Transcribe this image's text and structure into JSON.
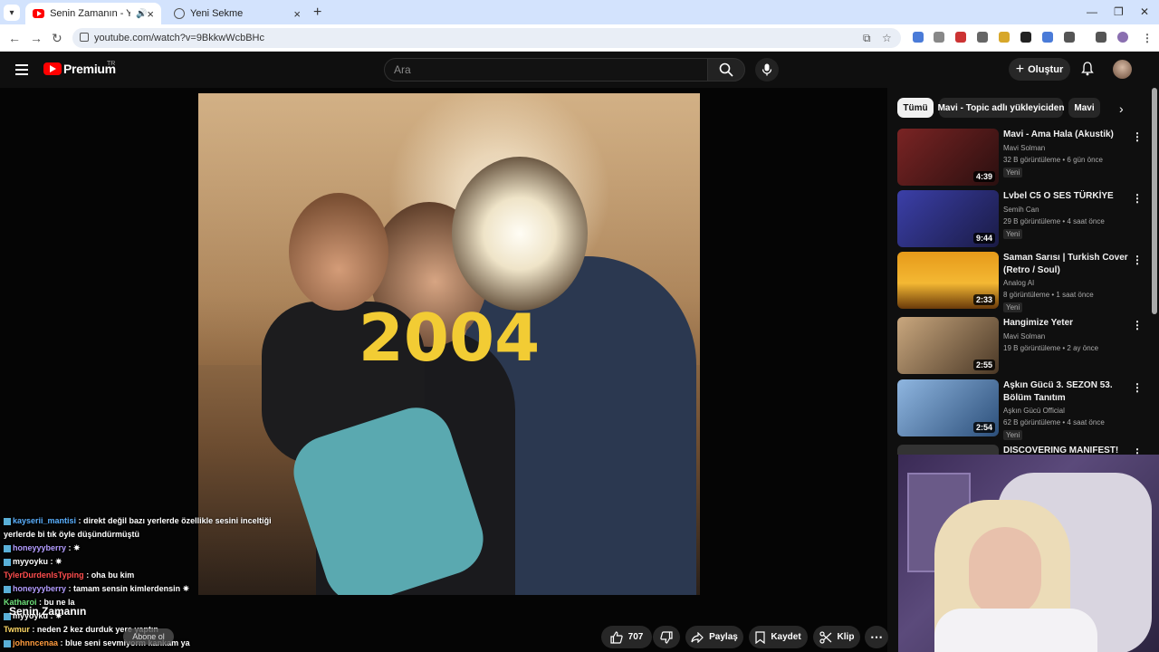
{
  "browser": {
    "tabs": [
      {
        "title": "Senin Zamanın - YouTube",
        "active": true
      },
      {
        "title": "Yeni Sekme",
        "active": false
      }
    ],
    "url": "youtube.com/watch?v=9BkkwWcbBHc"
  },
  "header": {
    "logo_text": "Premium",
    "region": "TR",
    "search_placeholder": "Ara",
    "create_label": "Oluştur"
  },
  "video": {
    "year_overlay": "2004",
    "title_overlay": "Senin Zamanın",
    "subscribe_overlay": "Abone ol",
    "likes": "707",
    "share_label": "Paylaş",
    "save_label": "Kaydet",
    "clip_label": "Klip"
  },
  "chat": [
    {
      "user": "kayserii_mantisi",
      "color": "#5ab0ff",
      "text": "direkt değil bazı yerlerde özellikle sesini inceltiği yerlerde bi tık öyle düşündürmüştü"
    },
    {
      "user": "honeyyyberry",
      "color": "#b39cff",
      "text": ""
    },
    {
      "user": "myyoyku",
      "color": "#ffffff",
      "text": ""
    },
    {
      "user": "TylerDurdenIsTyping",
      "color": "#ff4d4d",
      "text": "oha bu kim"
    },
    {
      "user": "honeyyyberry",
      "color": "#b39cff",
      "text": "tamam sensin kimlerdensin"
    },
    {
      "user": "Katharoi",
      "color": "#6ee07a",
      "text": "bu ne la"
    },
    {
      "user": "myyoyku",
      "color": "#ffffff",
      "text": ""
    },
    {
      "user": "Twmur",
      "color": "#ffd966",
      "text": "neden 2 kez durduk yere yaptın"
    },
    {
      "user": "johnncenaa",
      "color": "#ff9b3d",
      "text": "blue seni sevmiyorm kankam ya"
    }
  ],
  "chips": [
    {
      "label": "Tümü",
      "active": true
    },
    {
      "label": "Mavi - Topic adlı yükleyiciden",
      "active": false
    },
    {
      "label": "Mavi",
      "active": false
    }
  ],
  "recommendations": [
    {
      "title": "Mavi - Ama Hala (Akustik)",
      "channel": "Mavi Solman",
      "meta": "32 B görüntüleme • 6 gün önce",
      "new": "Yeni",
      "duration": "4:39",
      "thumb": "#5a1e1e"
    },
    {
      "title": "Lvbel C5 O SES TÜRKİYE",
      "channel": "Semih Can",
      "meta": "29 B görüntüleme • 4 saat önce",
      "new": "Yeni",
      "duration": "9:44",
      "thumb": "#2a2f7a"
    },
    {
      "title": "Saman Sarısı | Turkish Cover (Retro / Soul)",
      "channel": "Analog AI",
      "meta": "8 görüntüleme • 1 saat önce",
      "new": "Yeni",
      "duration": "2:33",
      "thumb": "#d9840c"
    },
    {
      "title": "Hangimize Yeter",
      "channel": "Mavi Solman",
      "meta": "19 B görüntüleme • 2 ay önce",
      "new": "",
      "duration": "2:55",
      "thumb": "#8b6b4a"
    },
    {
      "title": "Aşkın Gücü 3. SEZON 53. Bölüm Tanıtım",
      "channel": "Aşkın Gücü Official",
      "meta": "62 B görüntüleme • 4 saat önce",
      "new": "Yeni",
      "duration": "2:54",
      "thumb": "#3b6aa8"
    },
    {
      "title": "DISCOVERING MANIFEST!",
      "channel": "",
      "meta": "",
      "new": "",
      "duration": "",
      "thumb": "#333"
    }
  ],
  "icons": {
    "menu": "hamburger-icon",
    "search": "search-icon",
    "mic": "mic-icon",
    "bell": "bell-icon",
    "like": "thumbs-up-icon",
    "dislike": "thumbs-down-icon",
    "share": "share-icon",
    "save": "bookmark-icon",
    "clip": "scissors-icon",
    "more": "more-icon"
  }
}
